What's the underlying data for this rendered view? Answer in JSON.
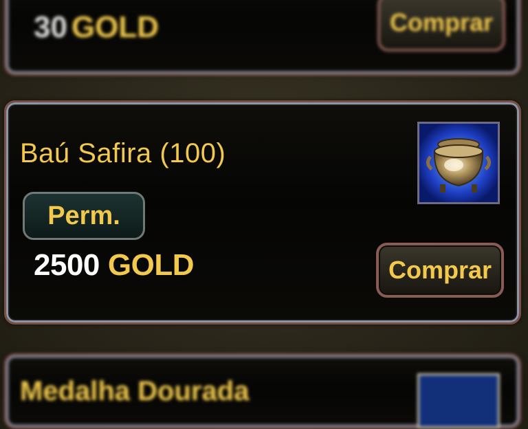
{
  "cards": {
    "top": {
      "amount": "30",
      "currency": "GOLD",
      "buy_label": "Comprar"
    },
    "main": {
      "title": "Baú Safira (100)",
      "duration_badge": "Perm.",
      "amount": "2500",
      "currency": "GOLD",
      "buy_label": "Comprar",
      "item_icon": "sapphire-chest-icon"
    },
    "bottom": {
      "title": "Medalha Dourada",
      "item_icon": "item-thumbnail-icon"
    }
  },
  "colors": {
    "gold_text": "#f2c94c",
    "card_border": "#7a4f46",
    "icon_frame_blue": "#0b1a6e"
  }
}
